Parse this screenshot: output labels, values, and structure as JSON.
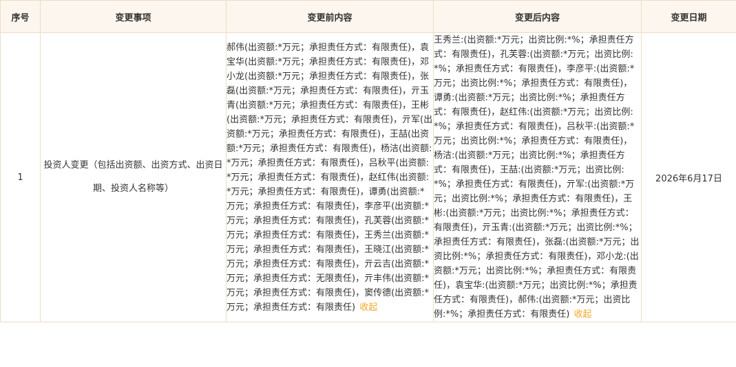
{
  "table": {
    "headers": [
      "序号",
      "变更事项",
      "变更前内容",
      "变更后内容",
      "变更日期"
    ],
    "rows": [
      {
        "index": "1",
        "item": "投资人变更（包括出资额、出资方式、出资日期、投资人名称等）",
        "before": "郝伟(出资额:*万元；承担责任方式：有限责任)，袁宝华(出资额:*万元；承担责任方式：有限责任)，邓小龙(出资额:*万元；承担责任方式：有限责任)，张磊(出资额:*万元；承担责任方式：有限责任)，亓玉青(出资额:*万元；承担责任方式：有限责任)，王彬(出资额:*万元；承担责任方式：有限责任)，亓军(出资额:*万元；承担责任方式：有限责任)，王喆(出资额:*万元；承担责任方式：有限责任)，杨洁(出资额:*万元；承担责任方式：有限责任)，吕秋平(出资额:*万元；承担责任方式：有限责任)，赵红伟(出资额:*万元；承担责任方式：有限责任)，谭勇(出资额:*万元；承担责任方式：有限责任)，李彦平(出资额:*万元；承担责任方式：有限责任)，孔芙蓉(出资额:*万元；承担责任方式：有限责任)，王秀兰(出资额:*万元；承担责任方式：有限责任)，王晓江(出资额:*万元；承担责任方式：有限责任)，亓云吉(出资额:*万元；承担责任方式：无限责任)，亓丰伟(出资额:*万元；承担责任方式：有限责任)，窦传德(出资额:*万元；承担责任方式：有限责任)",
        "after": "王秀兰:(出资额:*万元；出资比例:*%；承担责任方式：有限责任)，孔芙蓉:(出资额:*万元；出资比例:*%；承担责任方式：有限责任)，李彦平:(出资额:*万元；出资比例:*%；承担责任方式：有限责任)，谭勇:(出资额:*万元；出资比例:*%；承担责任方式：有限责任)，赵红伟:(出资额:*万元；出资比例:*%；承担责任方式：有限责任)，吕秋平:(出资额:*万元；出资比例:*%；承担责任方式：有限责任)，杨洁:(出资额:*万元；出资比例:*%；承担责任方式：有限责任)，王喆:(出资额:*万元；出资比例:*%；承担责任方式：有限责任)，亓军:(出资额:*万元；出资比例:*%；承担责任方式：有限责任)，王彬:(出资额:*万元；出资比例:*%；承担责任方式：有限责任)，亓玉青:(出资额:*万元；出资比例:*%；承担责任方式：有限责任)，张磊:(出资额:*万元；出资比例:*%；承担责任方式：有限责任)，邓小龙:(出资额:*万元；出资比例:*%；承担责任方式：有限责任)，袁宝华:(出资额:*万元；出资比例:*%；承担责任方式：有限责任)，郝伟:(出资额:*万元；出资比例:*%；承担责任方式：有限责任)",
        "date": "2026年6月17日",
        "collapse_label": "收起"
      }
    ]
  },
  "colors": {
    "header_bg": "#fcf6ee",
    "border": "#ecdcc6",
    "text": "#333333",
    "link": "#f5a623"
  }
}
